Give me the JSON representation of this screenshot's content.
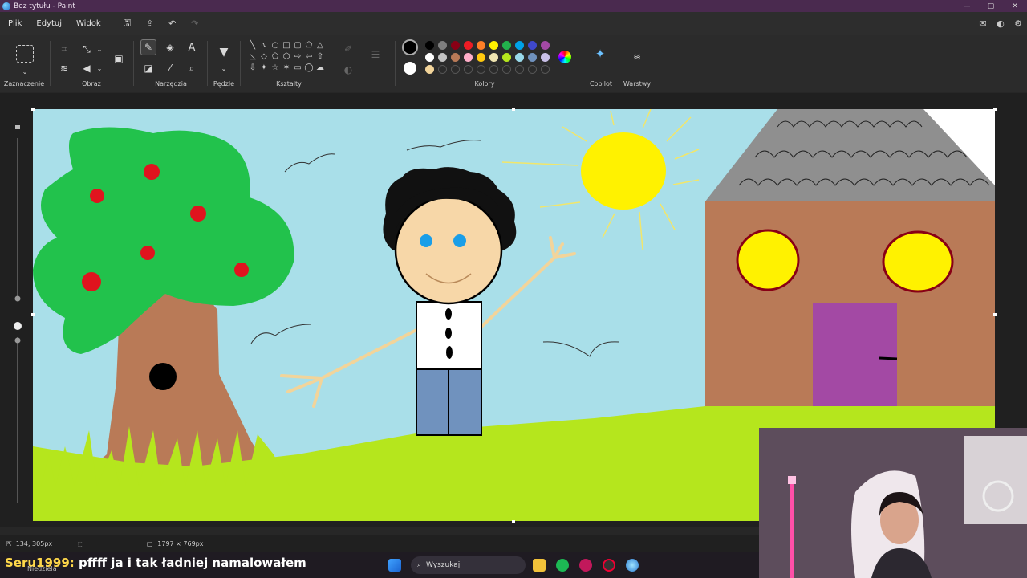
{
  "window": {
    "title": "Bez tytułu - Paint",
    "controls": [
      "—",
      "▢",
      "✕"
    ]
  },
  "menu": {
    "items": [
      "Plik",
      "Edytuj",
      "Widok"
    ]
  },
  "ribbon": {
    "groups": {
      "selection": "Zaznaczenie",
      "image": "Obraz",
      "tools": "Narzędzia",
      "brushes": "Pędzle",
      "shapes": "Kształty",
      "colors": "Kolory",
      "copilot": "Copilot",
      "layers": "Warstwy"
    },
    "swatches_row1": [
      "#000000",
      "#7f7f7f",
      "#880015",
      "#ed1c24",
      "#ff7f27",
      "#fff200",
      "#22b14c",
      "#00a2e8",
      "#3f48cc",
      "#a349a4"
    ],
    "swatches_row2": [
      "#ffffff",
      "#c3c3c3",
      "#b97a57",
      "#ffaec9",
      "#ffc90e",
      "#efe4b0",
      "#b5e61d",
      "#99d9ea",
      "#7092be",
      "#c8bfe7"
    ],
    "swatches_row3": [
      "#f2d49a"
    ],
    "primary_color": "#000000",
    "secondary_color": "#ffffff"
  },
  "status": {
    "cursor_pos": "134, 305px",
    "canvas_size": "1797 × 769px"
  },
  "overlay": {
    "chat_user": "Seru1999:",
    "chat_message": "pffff ja i tak ładniej namalowałem",
    "stream_tag": "Niedziela"
  },
  "taskbar": {
    "search_placeholder": "Wyszukaj"
  }
}
